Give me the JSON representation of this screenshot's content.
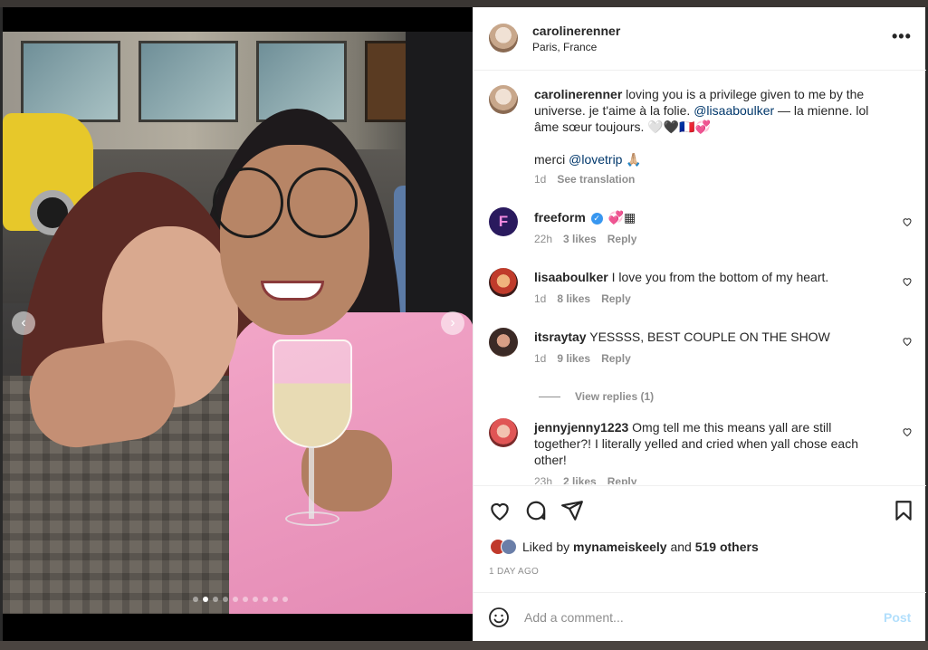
{
  "post": {
    "username": "carolinerenner",
    "location": "Paris, France",
    "more_label": "•••",
    "carousel": {
      "prev_label": "‹",
      "next_label": "›",
      "slide_count": 10,
      "active_slide": 2
    },
    "caption": {
      "username": "carolinerenner",
      "text_a": "loving you is a privilege given to me by the universe. je t'aime à la folie.",
      "mention_a": "@lisaaboulker",
      "text_b": "— la mienne. lol âme sœur toujours. 🤍🖤🇫🇷💞",
      "line2_text": "merci",
      "mention_b": "@lovetrip",
      "line2_emoji": "🙏🏼",
      "time": "1d",
      "translate": "See translation"
    },
    "comments": [
      {
        "username": "freeform",
        "text": "💞▦",
        "time": "22h",
        "likes": "3 likes",
        "reply": "Reply",
        "avatar_letter": "F"
      },
      {
        "username": "lisaaboulker",
        "text": "I love you from the bottom of my heart.",
        "time": "1d",
        "likes": "8 likes",
        "reply": "Reply"
      },
      {
        "username": "itsraytay",
        "text": "YESSSS, BEST COUPLE ON THE SHOW",
        "time": "1d",
        "likes": "9 likes",
        "reply": "Reply"
      },
      {
        "username": "jennyjenny1223",
        "text": "Omg tell me this means yall are still together?! I literally yelled and cried when yall chose each other!",
        "time": "23h",
        "likes": "2 likes",
        "reply": "Reply"
      }
    ],
    "view_replies": "View replies (1)",
    "liked_by_prefix": "Liked by",
    "liked_by_user": "mynameiskeely",
    "liked_by_and": "and",
    "liked_by_count": "519 others",
    "time_ago": "1 DAY AGO",
    "add_comment_placeholder": "Add a comment...",
    "post_button": "Post"
  },
  "icons": {
    "like": "heart-icon",
    "comment": "comment-icon",
    "share": "send-icon",
    "save": "bookmark-icon",
    "emoji": "emoji-icon",
    "verified": "verified-badge-icon"
  },
  "colors": {
    "mention": "#00376b",
    "muted": "#8e8e8e",
    "post_button_disabled": "#b2dffc",
    "verified": "#3897f0"
  }
}
